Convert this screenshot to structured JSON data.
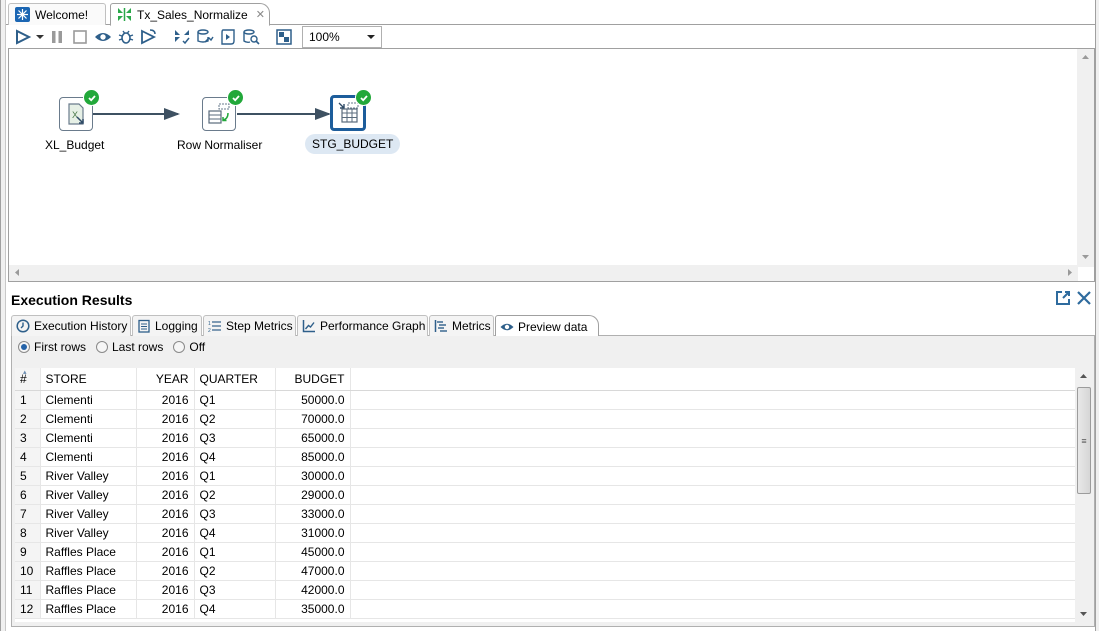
{
  "editor_tabs": [
    {
      "label": "Welcome!",
      "icon": "welcome-icon",
      "active": false
    },
    {
      "label": "Tx_Sales_Normalize",
      "icon": "transformation-icon",
      "active": true,
      "closable": true
    }
  ],
  "toolbar": {
    "buttons": [
      "run-icon",
      "run-dropdown-icon",
      "pause-icon",
      "stop-icon",
      "preview-icon",
      "debug-icon",
      "replay-icon",
      "verify-icon",
      "impact-icon",
      "sql-icon",
      "explore-db-icon",
      "show-results-icon"
    ],
    "zoom_value": "100%"
  },
  "canvas": {
    "steps": [
      {
        "name": "XL_Budget",
        "status": "success",
        "selected": false
      },
      {
        "name": "Row Normaliser",
        "status": "success",
        "selected": false
      },
      {
        "name": "STG_BUDGET",
        "status": "success",
        "selected": true
      }
    ]
  },
  "results": {
    "title": "Execution Results",
    "tabs": [
      {
        "label": "Execution History",
        "icon": "clock-icon"
      },
      {
        "label": "Logging",
        "icon": "log-icon"
      },
      {
        "label": "Step Metrics",
        "icon": "list-icon"
      },
      {
        "label": "Performance Graph",
        "icon": "graph-icon"
      },
      {
        "label": "Metrics",
        "icon": "metrics-icon"
      },
      {
        "label": "Preview data",
        "icon": "eye-icon",
        "active": true
      }
    ],
    "radio_options": [
      {
        "label": "First rows",
        "checked": true
      },
      {
        "label": "Last rows",
        "checked": false
      },
      {
        "label": "Off",
        "checked": false
      }
    ],
    "table": {
      "columns": [
        "#",
        "STORE",
        "YEAR",
        "QUARTER",
        "BUDGET"
      ],
      "rows": [
        [
          "1",
          "Clementi",
          "2016",
          "Q1",
          "50000.0"
        ],
        [
          "2",
          "Clementi",
          "2016",
          "Q2",
          "70000.0"
        ],
        [
          "3",
          "Clementi",
          "2016",
          "Q3",
          "65000.0"
        ],
        [
          "4",
          "Clementi",
          "2016",
          "Q4",
          "85000.0"
        ],
        [
          "5",
          "River Valley",
          "2016",
          "Q1",
          "30000.0"
        ],
        [
          "6",
          "River Valley",
          "2016",
          "Q2",
          "29000.0"
        ],
        [
          "7",
          "River Valley",
          "2016",
          "Q3",
          "33000.0"
        ],
        [
          "8",
          "River Valley",
          "2016",
          "Q4",
          "31000.0"
        ],
        [
          "9",
          "Raffles Place",
          "2016",
          "Q1",
          "45000.0"
        ],
        [
          "10",
          "Raffles Place",
          "2016",
          "Q2",
          "47000.0"
        ],
        [
          "11",
          "Raffles Place",
          "2016",
          "Q3",
          "42000.0"
        ],
        [
          "12",
          "Raffles Place",
          "2016",
          "Q4",
          "35000.0"
        ]
      ]
    }
  },
  "colors": {
    "accent": "#1d5d9b",
    "success": "#22a83a",
    "hop": "#3e5162"
  }
}
